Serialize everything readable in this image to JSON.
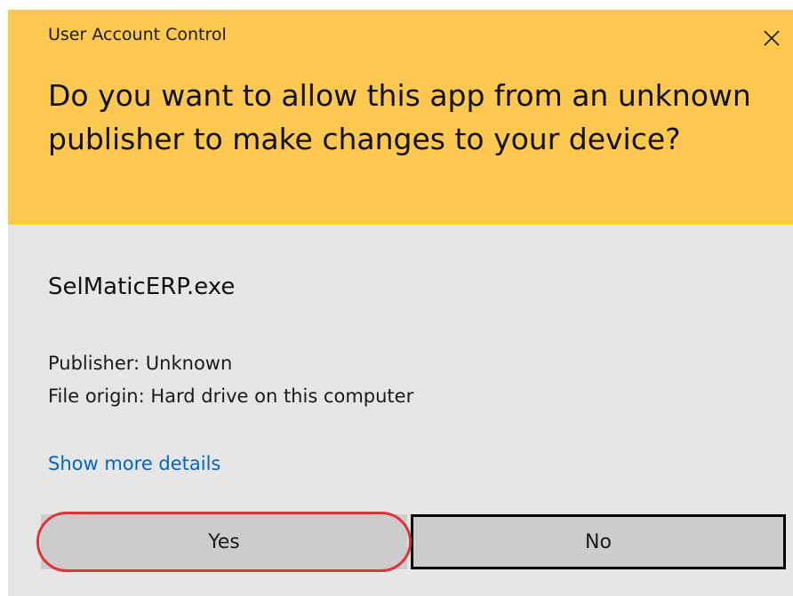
{
  "window": {
    "caption": "User Account Control",
    "close_icon": "close-icon"
  },
  "prompt": {
    "question": "Do you want to allow this app from an unknown publisher to make changes to your device?"
  },
  "app": {
    "name": "SelMaticERP.exe",
    "publisher": "Publisher: Unknown",
    "origin": "File origin: Hard drive on this computer"
  },
  "links": {
    "show_details": "Show more details"
  },
  "buttons": {
    "yes": "Yes",
    "no": "No"
  },
  "colors": {
    "header_bg": "#fcc84f",
    "body_bg": "#e6e6e6",
    "link": "#0067c0",
    "button_bg": "#cccccc",
    "highlight": "#e0333a"
  }
}
